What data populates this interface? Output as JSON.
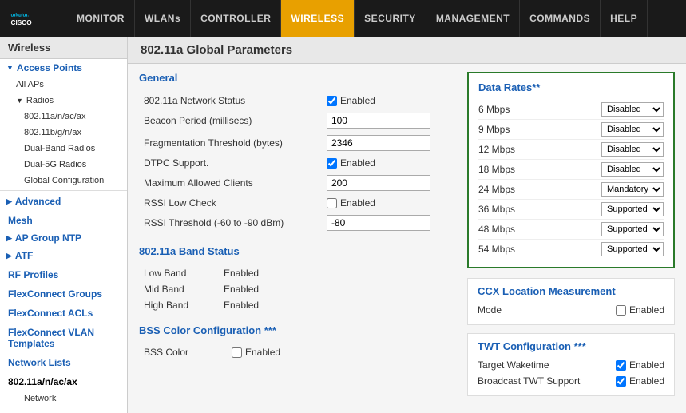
{
  "navbar": {
    "items": [
      {
        "label": "MONITOR",
        "id": "monitor",
        "active": false
      },
      {
        "label": "WLANs",
        "id": "wlans",
        "active": false
      },
      {
        "label": "CONTROLLER",
        "id": "controller",
        "active": false
      },
      {
        "label": "WIRELESS",
        "id": "wireless",
        "active": true
      },
      {
        "label": "SECURITY",
        "id": "security",
        "active": false
      },
      {
        "label": "MANAGEMENT",
        "id": "management",
        "active": false
      },
      {
        "label": "COMMANDS",
        "id": "commands",
        "active": false
      },
      {
        "label": "HELP",
        "id": "help",
        "active": false
      }
    ]
  },
  "sidebar": {
    "title": "Wireless",
    "sections": [
      {
        "label": "Access Points",
        "type": "section-open",
        "items": [
          {
            "label": "All APs",
            "level": 1
          },
          {
            "label": "Radios",
            "level": 1,
            "expanded": true
          },
          {
            "label": "802.11a/n/ac/ax",
            "level": 2
          },
          {
            "label": "802.11b/g/n/ax",
            "level": 2
          },
          {
            "label": "Dual-Band Radios",
            "level": 2
          },
          {
            "label": "Dual-5G Radios",
            "level": 2
          },
          {
            "label": "Global Configuration",
            "level": 2
          }
        ]
      },
      {
        "label": "Advanced",
        "type": "section-collapsed"
      },
      {
        "label": "Mesh",
        "type": "plain"
      },
      {
        "label": "AP Group NTP",
        "type": "section-collapsed"
      },
      {
        "label": "ATF",
        "type": "section-collapsed"
      },
      {
        "label": "RF Profiles",
        "type": "plain"
      },
      {
        "label": "FlexConnect Groups",
        "type": "plain"
      },
      {
        "label": "FlexConnect ACLs",
        "type": "plain"
      },
      {
        "label": "FlexConnect VLAN Templates",
        "type": "plain"
      },
      {
        "label": "Network Lists",
        "type": "plain"
      },
      {
        "label": "802.11a/n/ac/ax",
        "type": "section-open-bold"
      },
      {
        "label": "Network",
        "level": 2
      }
    ]
  },
  "page": {
    "title": "802.11a Global Parameters"
  },
  "general": {
    "section_title": "General",
    "fields": [
      {
        "label": "802.11a Network Status",
        "type": "checkbox",
        "checked": true,
        "value": "Enabled"
      },
      {
        "label": "Beacon Period (millisecs)",
        "type": "text",
        "value": "100"
      },
      {
        "label": "Fragmentation Threshold (bytes)",
        "type": "text",
        "value": "2346"
      },
      {
        "label": "DTPC Support.",
        "type": "checkbox",
        "checked": true,
        "value": "Enabled"
      },
      {
        "label": "Maximum Allowed Clients",
        "type": "text",
        "value": "200"
      },
      {
        "label": "RSSI Low Check",
        "type": "checkbox",
        "checked": false,
        "value": "Enabled"
      },
      {
        "label": "RSSI Threshold (-60 to -90 dBm)",
        "type": "text",
        "value": "-80"
      }
    ]
  },
  "band_status": {
    "section_title": "802.11a Band Status",
    "rows": [
      {
        "label": "Low Band",
        "value": "Enabled"
      },
      {
        "label": "Mid Band",
        "value": "Enabled"
      },
      {
        "label": "High Band",
        "value": "Enabled"
      }
    ]
  },
  "bss_color": {
    "section_title": "BSS Color Configuration ***",
    "label": "BSS Color",
    "checked": false,
    "value": "Enabled"
  },
  "data_rates": {
    "title": "Data Rates**",
    "rates": [
      {
        "label": "6 Mbps",
        "value": "Disabled",
        "options": [
          "Disabled",
          "Mandatory",
          "Supported"
        ]
      },
      {
        "label": "9 Mbps",
        "value": "Disabled",
        "options": [
          "Disabled",
          "Mandatory",
          "Supported"
        ]
      },
      {
        "label": "12 Mbps",
        "value": "Disabled",
        "options": [
          "Disabled",
          "Mandatory",
          "Supported"
        ]
      },
      {
        "label": "18 Mbps",
        "value": "Disabled",
        "options": [
          "Disabled",
          "Mandatory",
          "Supported"
        ]
      },
      {
        "label": "24 Mbps",
        "value": "Mandatory",
        "options": [
          "Disabled",
          "Mandatory",
          "Supported"
        ]
      },
      {
        "label": "36 Mbps",
        "value": "Supported",
        "options": [
          "Disabled",
          "Mandatory",
          "Supported"
        ]
      },
      {
        "label": "48 Mbps",
        "value": "Supported",
        "options": [
          "Disabled",
          "Mandatory",
          "Supported"
        ]
      },
      {
        "label": "54 Mbps",
        "value": "Supported",
        "options": [
          "Disabled",
          "Mandatory",
          "Supported"
        ]
      }
    ]
  },
  "ccx": {
    "title": "CCX Location Measurement",
    "mode_label": "Mode",
    "mode_checked": false,
    "mode_value": "Enabled"
  },
  "twt": {
    "title": "TWT Configuration ***",
    "rows": [
      {
        "label": "Target Waketime",
        "checked": true,
        "value": "Enabled"
      },
      {
        "label": "Broadcast TWT Support",
        "checked": true,
        "value": "Enabled"
      }
    ]
  }
}
